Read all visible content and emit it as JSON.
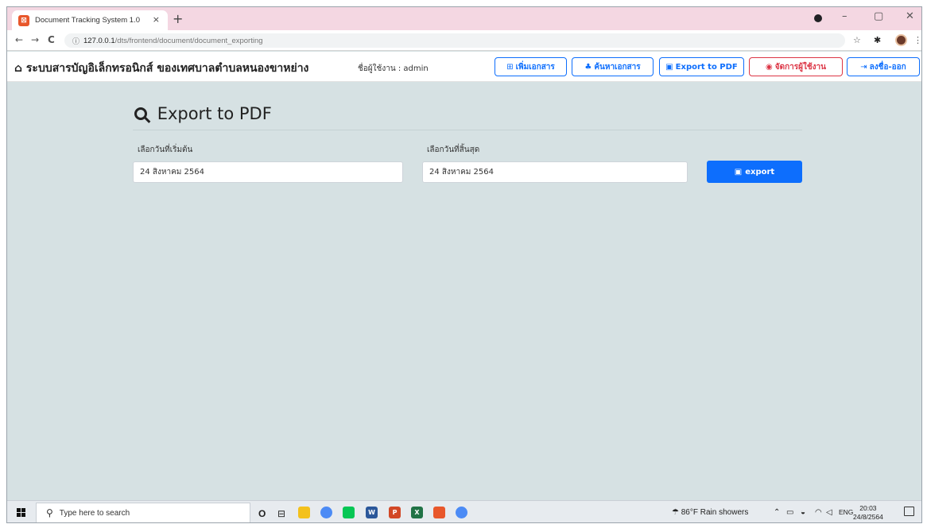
{
  "browser": {
    "tab_title": "Document Tracking System 1.0",
    "tab_close": "×",
    "new_tab": "+",
    "favicon": "⊠",
    "url_host": "127.0.0.1",
    "url_path": "/dts/frontend/document/document_exporting",
    "nav": {
      "back": "←",
      "forward": "→",
      "reload": "C"
    },
    "window_controls": {
      "minimize": "–",
      "maximize": "▢",
      "close": "✕"
    }
  },
  "navbar": {
    "brand": "ระบบสารบัญอิเล็กทรอนิกส์ ของเทศบาลตำบลหนองขาหย่าง",
    "user_label": "ชื่อผู้ใช้งาน : admin",
    "buttons": [
      {
        "label": "เพิ่มเอกสาร",
        "icon": "⊞"
      },
      {
        "label": "ค้นหาเอกสาร",
        "icon": "♣"
      },
      {
        "label": "Export to PDF",
        "icon": "▣"
      },
      {
        "label": "จัดการผู้ใช้งาน",
        "icon": "◉"
      },
      {
        "label": "ลงชื่อ-ออก",
        "icon": "⇥"
      }
    ]
  },
  "main": {
    "title": "Export to PDF",
    "start_label": "เลือกวันที่เริ่มต้น",
    "start_value": "24 สิงหาคม 2564",
    "end_label": "เลือกวันที่สิ้นสุด",
    "end_value": "24 สิงหาคม 2564",
    "export_label": "export",
    "export_icon": "▣"
  },
  "taskbar": {
    "search_placeholder": "Type here to search",
    "weather": "86°F  Rain showers",
    "lang": "ENG",
    "time": "20:03",
    "date": "24/8/2564"
  },
  "colors": {
    "primary": "#0d6efd",
    "danger": "#dc3545",
    "page_bg": "#d6e1e3"
  }
}
